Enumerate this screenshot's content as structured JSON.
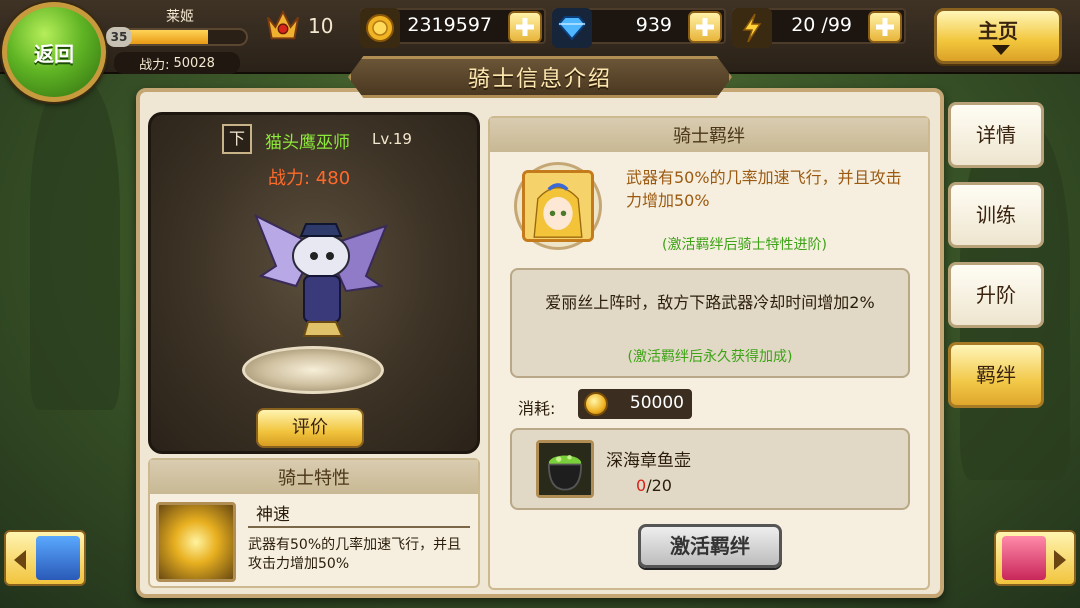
{
  "player": {
    "name": "莱姬",
    "level": "35",
    "power_label": "战力:",
    "power_value": "50028",
    "exp_fraction": 0.72
  },
  "vip": {
    "level": "10"
  },
  "resources": {
    "gold": "2319597",
    "gems": "939",
    "energy": "20 /99"
  },
  "top": {
    "back_label": "返回",
    "home_label": "主页"
  },
  "page_title": "骑士信息介绍",
  "hero": {
    "position_tag": "下",
    "name": "猫头鹰巫师",
    "level": "Lv.19",
    "power": "战力:  480",
    "eval_label": "评价"
  },
  "trait": {
    "section_title": "骑士特性",
    "name": "神速",
    "desc": "武器有50%的几率加速飞行，并且攻击力增加50%"
  },
  "bond": {
    "section_title": "骑士羁绊",
    "effect": "武器有50%的几率加速飞行，并且攻击力增加50%",
    "effect_hint": "(激活羁绊后骑士特性进阶)",
    "extra": "爱丽丝上阵时，敌方下路武器冷却时间增加2%",
    "extra_hint": "(激活羁绊后永久获得加成)",
    "cost_label": "消耗:",
    "cost_value": "50000",
    "item_name": "深海章鱼壶",
    "item_have": "0",
    "item_need": "/20",
    "activate_label": "激活羁绊"
  },
  "side_tabs": [
    {
      "label": "详情",
      "active": false
    },
    {
      "label": "训练",
      "active": false
    },
    {
      "label": "升阶",
      "active": false
    },
    {
      "label": "羁绊",
      "active": true
    }
  ],
  "colors": {
    "accent_gold": "#f1c43d",
    "hero_name": "#8eea3a",
    "power_red": "#ff6a2a",
    "hint_green": "#3ba314",
    "bond_effect": "#9b5a10"
  }
}
